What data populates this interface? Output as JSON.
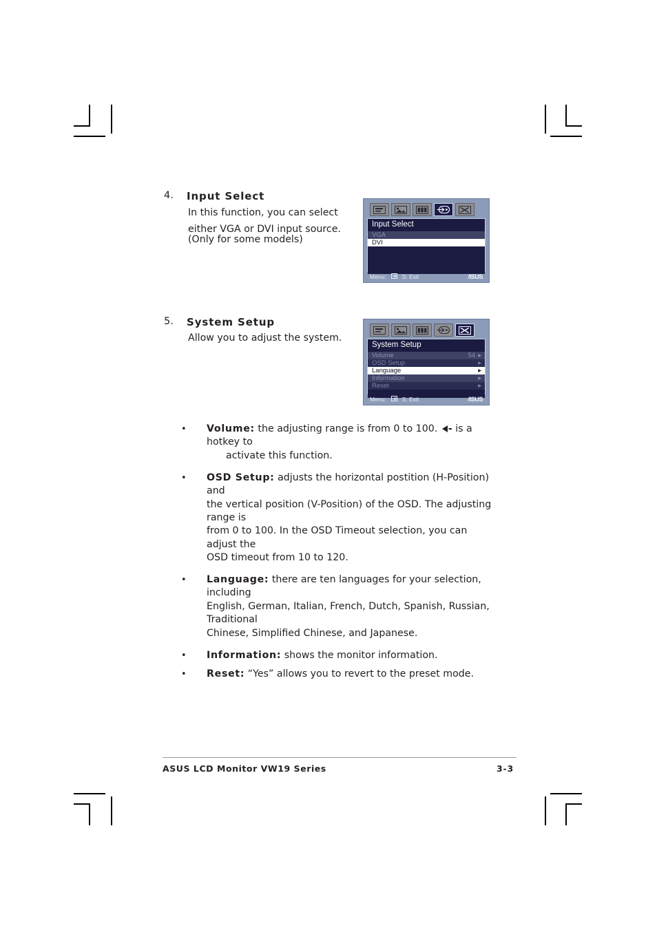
{
  "page": {
    "footer_title": "ASUS LCD Monitor VW19 Series",
    "page_number": "3-3"
  },
  "sections": [
    {
      "number": "4.",
      "heading": "Input Select",
      "body_line1": "In this function, you can select",
      "body_line2": "either VGA or DVI input source.",
      "body_line3": "(Only for some models)"
    },
    {
      "number": "5.",
      "heading": "System Setup",
      "body_line1": "Allow you to adjust the system."
    }
  ],
  "osd_input_select": {
    "title": "Input Select",
    "icons": [
      {
        "name": "splendid-icon",
        "selected": false
      },
      {
        "name": "image-icon",
        "selected": false
      },
      {
        "name": "color-icon",
        "selected": false
      },
      {
        "name": "input-select-icon",
        "selected": true
      },
      {
        "name": "system-setup-icon",
        "selected": false
      }
    ],
    "rows": [
      {
        "label": "VGA",
        "value": "",
        "state": "dim"
      },
      {
        "label": "DVI",
        "value": "",
        "state": "highlighted"
      }
    ],
    "footer_menu": "Menu:",
    "footer_menu_icon": "menu-key-icon",
    "footer_exit": "S: Exit",
    "brand": "/ISUS"
  },
  "osd_system_setup": {
    "title": "System Setup",
    "icons": [
      {
        "name": "splendid-icon",
        "selected": false
      },
      {
        "name": "image-icon",
        "selected": false
      },
      {
        "name": "color-icon",
        "selected": false
      },
      {
        "name": "input-select-icon",
        "selected": false
      },
      {
        "name": "system-setup-icon",
        "selected": true
      }
    ],
    "rows": [
      {
        "label": "Volume",
        "value": "54",
        "arrow": "▸",
        "state": "dim"
      },
      {
        "label": "OSD Setup",
        "value": "",
        "arrow": "▸",
        "state": "dim2"
      },
      {
        "label": "Language",
        "value": "",
        "arrow": "▸",
        "state": "highlighted"
      },
      {
        "label": "Information",
        "value": "",
        "arrow": "▸",
        "state": "dim"
      },
      {
        "label": "Reset",
        "value": "",
        "arrow": "▸",
        "state": "dim2"
      }
    ],
    "footer_menu": "Menu:",
    "footer_menu_icon": "menu-key-icon",
    "footer_exit": "S: Exit",
    "brand": "/ISUS"
  },
  "bullets": {
    "volume_label": "Volume:",
    "volume_text_before": "the adjusting range is from 0 to 100.",
    "volume_hotkey_icon": "left-arrow-hotkey-icon",
    "volume_text_after": "is a hotkey to",
    "volume_text_line2": "activate this function.",
    "osd_setup_label": "OSD Setup:",
    "osd_setup_line1": "adjusts the horizontal postition (H-Position) and",
    "osd_setup_line2": "the vertical position (V-Position) of the OSD. The adjusting range is",
    "osd_setup_line3": "from 0 to 100. In the OSD Timeout selection, you can adjust the",
    "osd_setup_line4": "OSD timeout from 10 to 120.",
    "language_label": "Language:",
    "language_line1": "there are ten languages for your selection, including",
    "language_line2": "English, German, Italian, French, Dutch, Spanish, Russian, Traditional",
    "language_line3": "Chinese, Simplified Chinese, and Japanese.",
    "information_label": "Information:",
    "information_text": "shows the monitor information.",
    "reset_label": "Reset:",
    "reset_text": "“Yes” allows you to revert to the preset mode.",
    "dot": "•"
  },
  "colors": {
    "osd_frame": "#8b9bb8",
    "osd_body": "#1b1b42",
    "osd_selected": "#ffffff",
    "text": "#231f20"
  }
}
